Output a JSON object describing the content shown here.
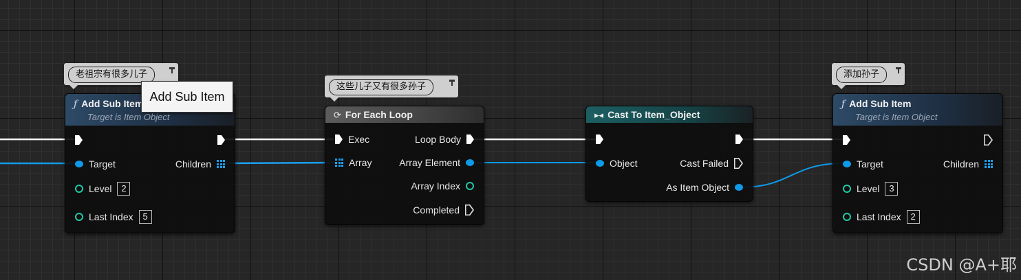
{
  "colors": {
    "exec": "#ffffff",
    "object": "#0e9ae8",
    "integer": "#1fc9a6",
    "array": "#1aa0f0"
  },
  "comments": {
    "c1": "老祖宗有很多儿子",
    "c2": "这些儿子又有很多孙子",
    "c3": "添加孙子"
  },
  "tooltip": "Add Sub Item",
  "node1": {
    "title": "Add Sub Item",
    "subtitle": "Target is Item Object",
    "icon": "function-icon",
    "pins": {
      "target": "Target",
      "children": "Children",
      "level": "Level",
      "last_index": "Last Index"
    },
    "level_value": "2",
    "last_index_value": "5"
  },
  "node2": {
    "title": "For Each Loop",
    "icon": "loop-icon",
    "pins": {
      "exec": "Exec",
      "array": "Array",
      "loop_body": "Loop Body",
      "array_element": "Array Element",
      "array_index": "Array Index",
      "completed": "Completed"
    }
  },
  "node3": {
    "title": "Cast To Item_Object",
    "icon": "cast-icon",
    "pins": {
      "object": "Object",
      "cast_failed": "Cast Failed",
      "as_item_object": "As Item Object"
    }
  },
  "node4": {
    "title": "Add Sub Item",
    "subtitle": "Target is Item Object",
    "icon": "function-icon",
    "pins": {
      "target": "Target",
      "children": "Children",
      "level": "Level",
      "last_index": "Last Index"
    },
    "level_value": "3",
    "last_index_value": "2"
  },
  "watermark": "CSDN @A+耶"
}
